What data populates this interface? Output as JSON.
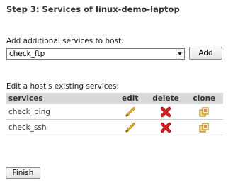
{
  "step": {
    "title": "Step 3:  Services of linux-demo-laptop"
  },
  "add_section": {
    "label": "Add additional services to host:",
    "selected_service": "check_ftp",
    "add_button": "Add"
  },
  "edit_section": {
    "label": "Edit a host's existing services:",
    "columns": {
      "services": "services",
      "edit": "edit",
      "delete": "delete",
      "clone": "clone"
    },
    "rows": [
      {
        "service": "check_ping"
      },
      {
        "service": "check_ssh"
      }
    ]
  },
  "finish_button": "Finish",
  "icons": {
    "edit": "pencil-icon",
    "delete": "red-x-delete-icon",
    "clone": "clone-document-icon"
  },
  "colors": {
    "header_bg": "#d8d8d8",
    "delete_red": "#e02020",
    "pencil_orange": "#e8a317"
  }
}
